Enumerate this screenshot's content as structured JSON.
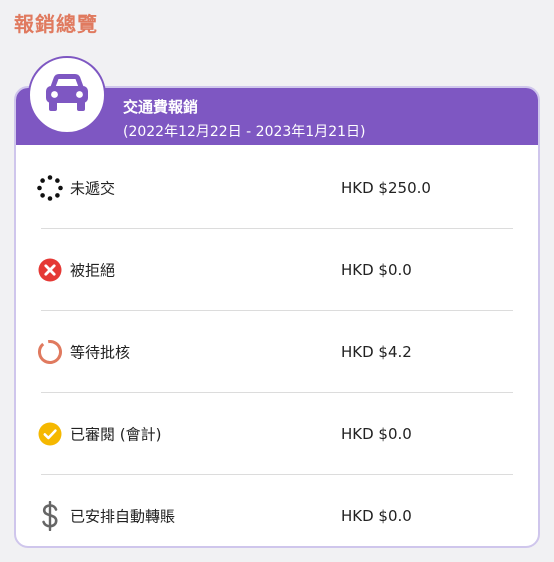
{
  "page": {
    "title": "報銷總覽"
  },
  "card": {
    "title": "交通費報銷",
    "period": "(2022年12月22日  -  2023年1月21日)",
    "avatar_icon": "car-icon",
    "accent_color": "#7e57c2"
  },
  "rows": [
    {
      "label": "未遞交",
      "amount": "HKD $250.0",
      "icon": "loading-dots-icon"
    },
    {
      "label": "被拒絕",
      "amount": "HKD $0.0",
      "icon": "rejected-icon",
      "color": "#e53935"
    },
    {
      "label": "等待批核",
      "amount": "HKD $4.2",
      "icon": "pending-ring-icon",
      "color": "#e07a5f"
    },
    {
      "label": "已審閱 (會計)",
      "amount": "HKD $0.0",
      "icon": "check-circle-icon",
      "color": "#f5b800"
    },
    {
      "label": "已安排自動轉賬",
      "amount": "HKD $0.0",
      "icon": "dollar-icon",
      "color": "#666666"
    }
  ]
}
